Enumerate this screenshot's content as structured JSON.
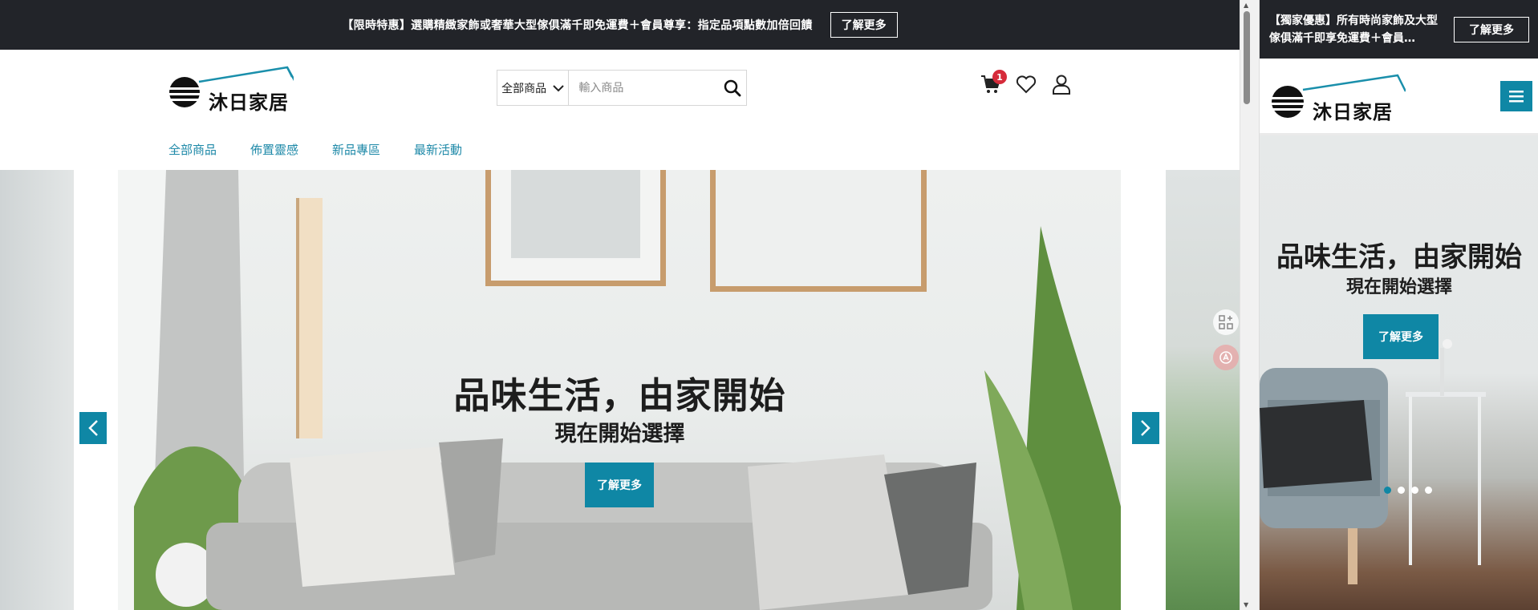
{
  "colors": {
    "accent": "#0f87a5",
    "topbar": "#222429",
    "nav_link": "#1e89a8",
    "badge": "#d62b3a"
  },
  "desktop": {
    "promo": {
      "text": "【限時特惠】選購精緻家飾或奢華大型傢俱滿千即免運費＋會員尊享：指定品項點數加倍回饋",
      "button": "了解更多"
    },
    "logo_text": "沐日家居",
    "search": {
      "category": "全部商品",
      "placeholder": "輸入商品",
      "value": ""
    },
    "cart_count": "1",
    "icons": [
      "cart-icon",
      "heart-icon",
      "user-icon",
      "search-icon",
      "chevron-down-icon"
    ],
    "nav": [
      "全部商品",
      "佈置靈感",
      "新品專區",
      "最新活動"
    ],
    "hero": {
      "title": "品味生活，由家開始",
      "subtitle": "現在開始選擇",
      "button": "了解更多"
    }
  },
  "mobile": {
    "promo": {
      "text": "【獨家優惠】所有時尚家飾及大型傢俱滿千即享免運費＋會員…",
      "button": "了解更多"
    },
    "logo_text": "沐日家居",
    "hero": {
      "title": "品味生活，由家開始",
      "subtitle": "現在開始選擇",
      "button": "了解更多"
    },
    "slides_total": 4,
    "active_slide": 1
  }
}
